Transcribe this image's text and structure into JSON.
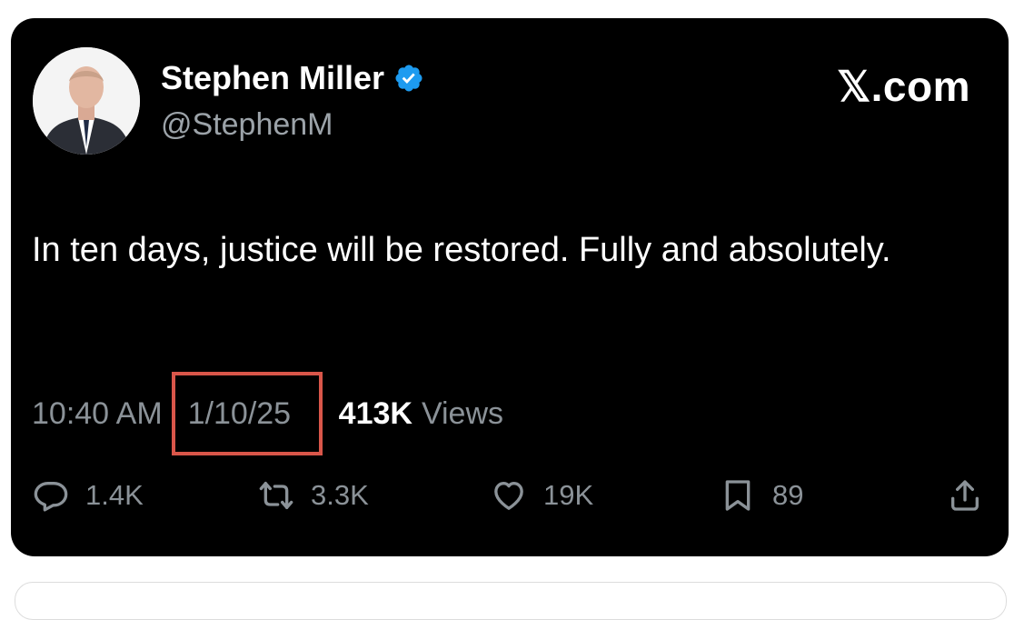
{
  "post": {
    "author_name": "Stephen Miller",
    "handle": "@StephenM",
    "brand": "𝕏.com",
    "text": "In ten days, justice will be restored. Fully and absolutely.",
    "time": "10:40 AM",
    "date": "1/10/25",
    "views_count": "413K",
    "views_label": "Views"
  },
  "actions": {
    "replies": "1.4K",
    "reposts": "3.3K",
    "likes": "19K",
    "bookmarks": "89"
  },
  "icons": {
    "verified": "verified-badge-icon",
    "reply": "comment-icon",
    "repost": "repost-icon",
    "like": "heart-icon",
    "bookmark": "bookmark-icon",
    "share": "share-icon"
  },
  "colors": {
    "card_background": "#000000",
    "verified_blue": "#1d9bf0",
    "highlight_box": "#d9564a",
    "muted_text": "#8b9298"
  }
}
